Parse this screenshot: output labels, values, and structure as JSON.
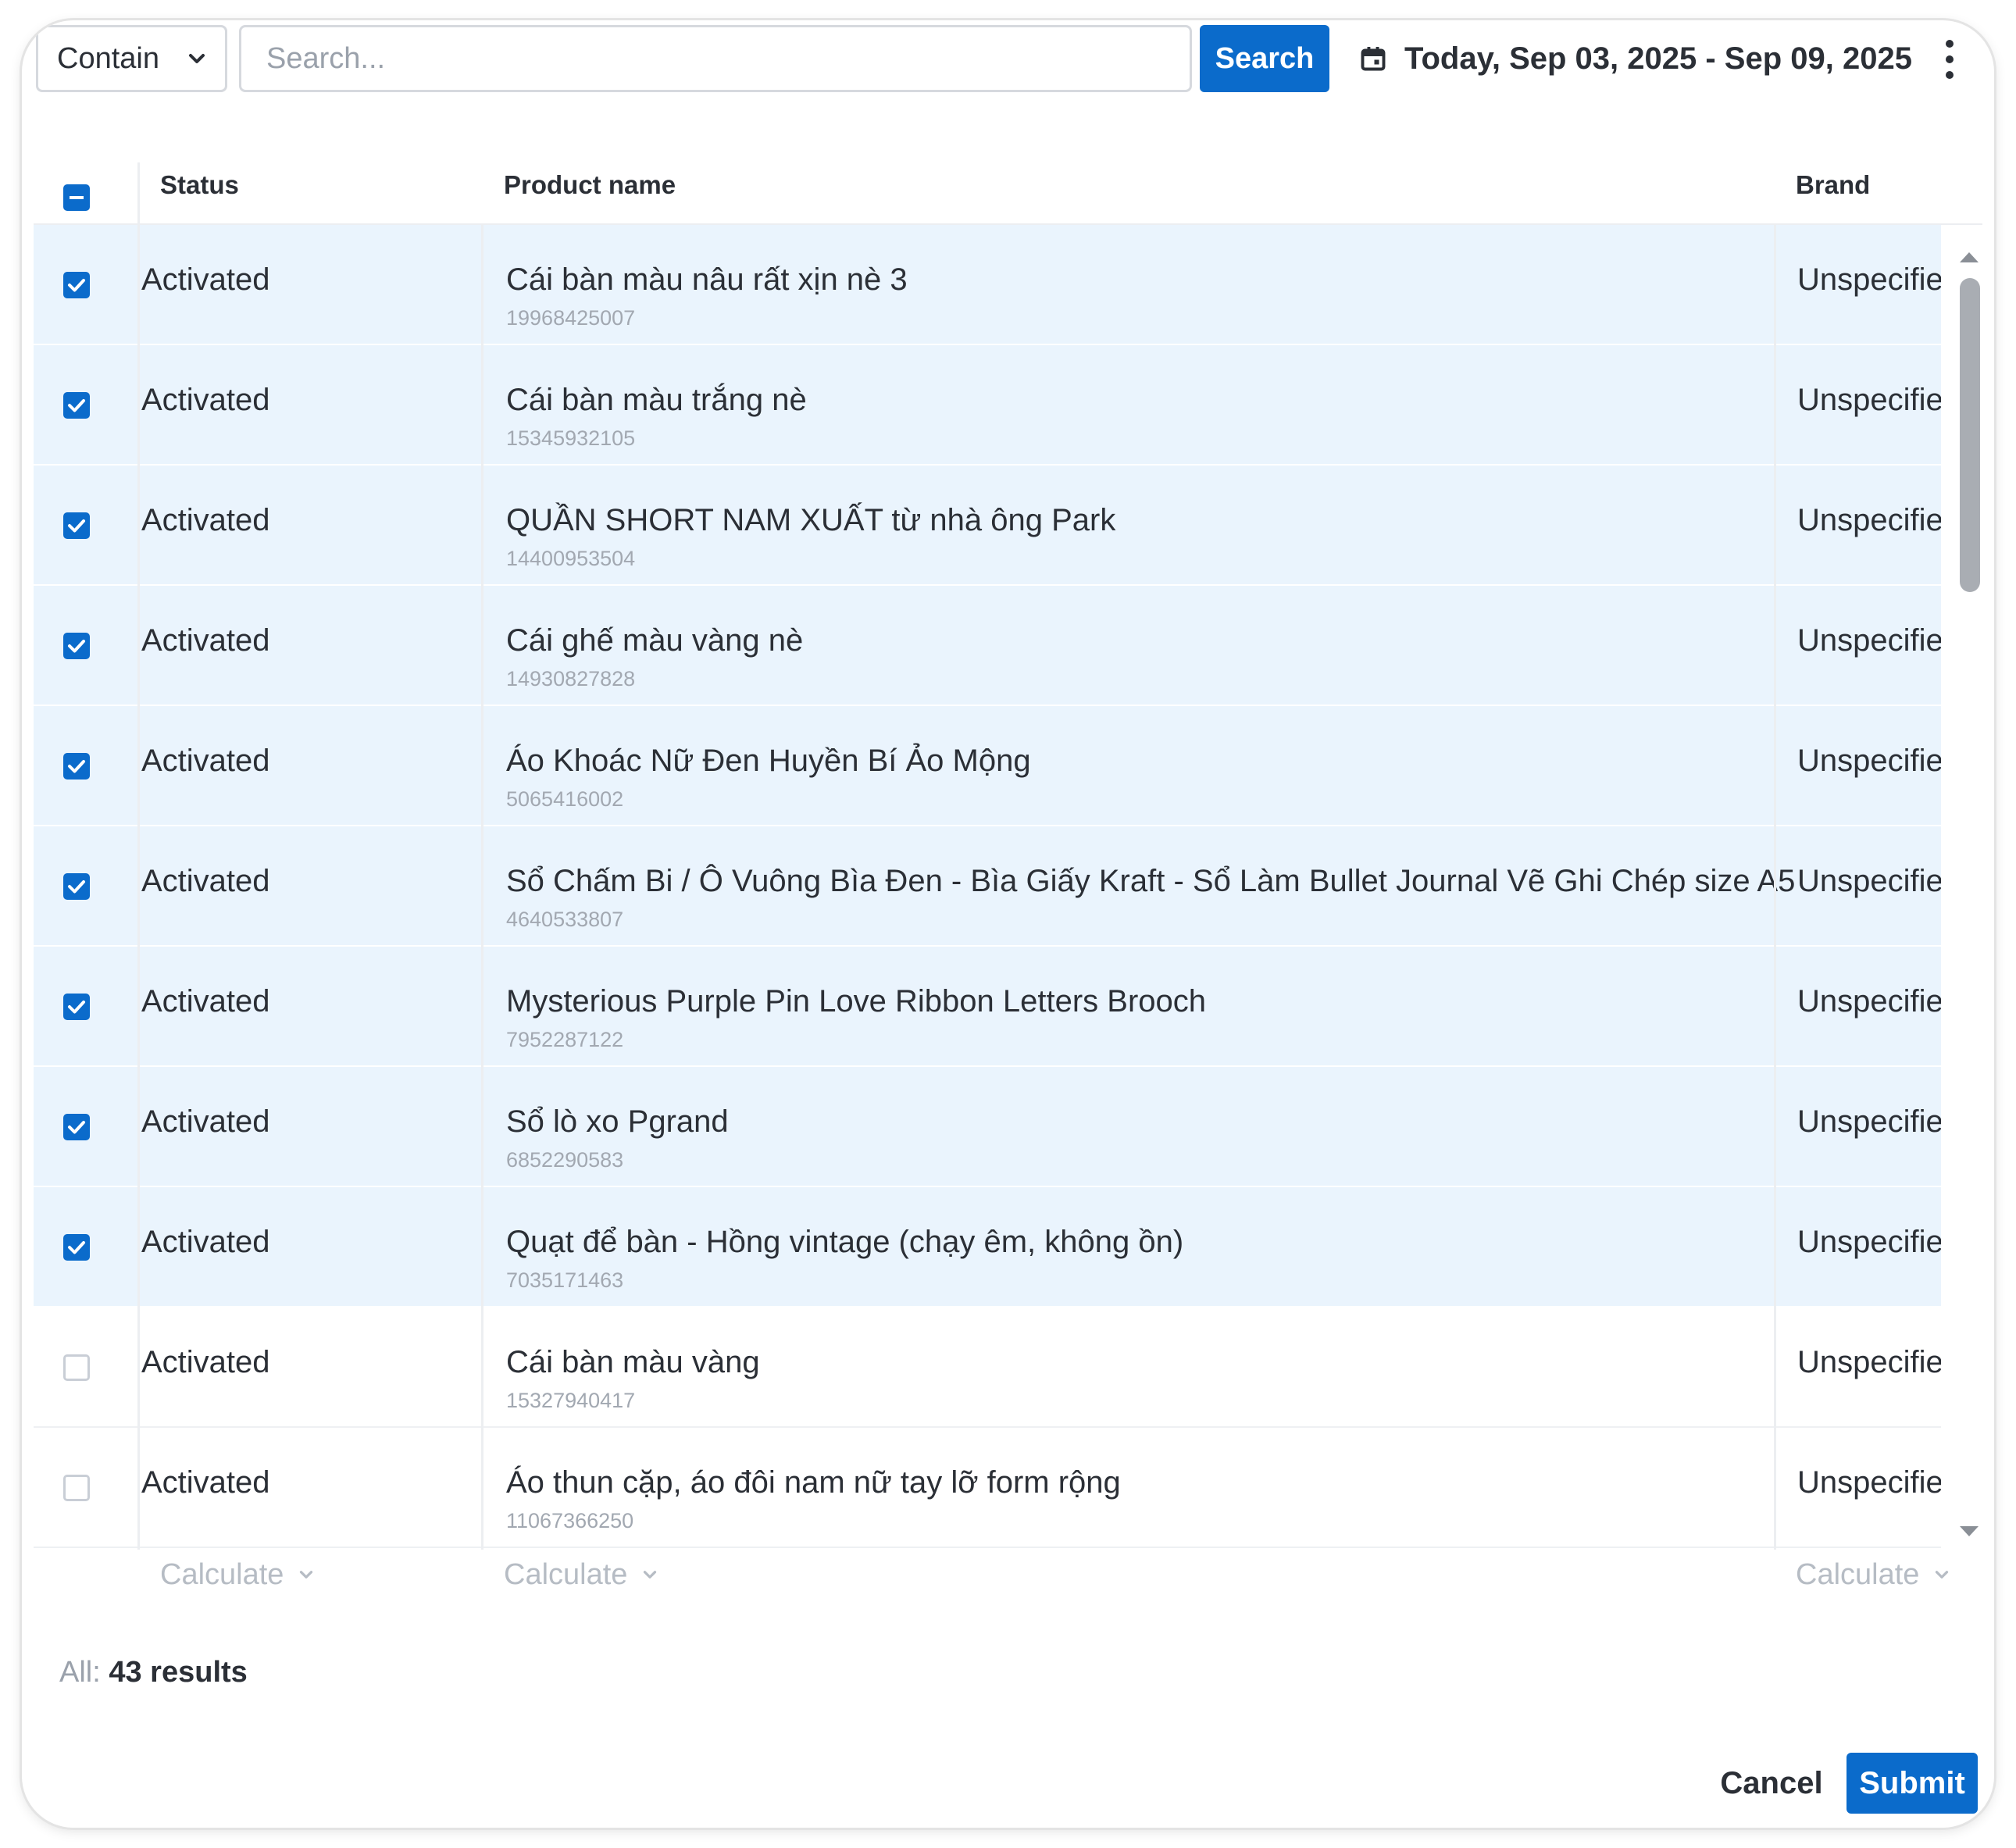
{
  "toolbar": {
    "mode_select_value": "Contain",
    "search_placeholder": "Search...",
    "search_value": "",
    "search_button_label": "Search",
    "date_range_label": "Today, Sep 03, 2025 - Sep 09, 2025"
  },
  "table": {
    "columns": {
      "status": "Status",
      "product_name": "Product name",
      "brand": "Brand"
    },
    "header_checkbox_state": "indeterminate",
    "rows": [
      {
        "selected": true,
        "status": "Activated",
        "name": "Cái bàn màu nâu rất xịn nè 3",
        "id": "19968425007",
        "brand": "Unspecified"
      },
      {
        "selected": true,
        "status": "Activated",
        "name": "Cái bàn màu trắng nè",
        "id": "15345932105",
        "brand": "Unspecified"
      },
      {
        "selected": true,
        "status": "Activated",
        "name": "QUẦN SHORT NAM XUẤT từ nhà ông Park",
        "id": "14400953504",
        "brand": "Unspecified"
      },
      {
        "selected": true,
        "status": "Activated",
        "name": "Cái ghế màu vàng nè",
        "id": "14930827828",
        "brand": "Unspecified"
      },
      {
        "selected": true,
        "status": "Activated",
        "name": "Áo Khoác Nữ Đen Huyền Bí Ảo Mộng",
        "id": "5065416002",
        "brand": "Unspecified"
      },
      {
        "selected": true,
        "status": "Activated",
        "name": "Sổ Chấm Bi / Ô Vuông Bìa Đen - Bìa Giấy Kraft - Sổ Làm Bullet Journal Vẽ Ghi Chép size A5",
        "id": "4640533807",
        "brand": "Unspecified"
      },
      {
        "selected": true,
        "status": "Activated",
        "name": "Mysterious Purple Pin Love Ribbon Letters Brooch",
        "id": "7952287122",
        "brand": "Unspecified"
      },
      {
        "selected": true,
        "status": "Activated",
        "name": "Sổ lò xo Pgrand",
        "id": "6852290583",
        "brand": "Unspecified"
      },
      {
        "selected": true,
        "status": "Activated",
        "name": "Quạt để bàn - Hồng vintage (chạy êm, không ồn)",
        "id": "7035171463",
        "brand": "Unspecified"
      },
      {
        "selected": false,
        "status": "Activated",
        "name": "Cái bàn màu vàng",
        "id": "15327940417",
        "brand": "Unspecified"
      },
      {
        "selected": false,
        "status": "Activated",
        "name": "Áo thun cặp, áo đôi nam nữ tay lỡ form rộng",
        "id": "11067366250",
        "brand": "Unspecified"
      }
    ],
    "footer": {
      "calc_label": "Calculate"
    }
  },
  "summary": {
    "prefix": "All:",
    "count_text": "43 results"
  },
  "actions": {
    "cancel_label": "Cancel",
    "submit_label": "Submit"
  },
  "colors": {
    "accent": "#0b6bcb",
    "selected_row_bg": "#eaf4fd",
    "text": "#2b2f36",
    "muted": "#9aa1ab"
  },
  "icons": {
    "mode_select": "chevron-down-icon",
    "date": "calendar-icon",
    "more": "more-vertical-icon",
    "checkbox_on": "checkbox-checked-icon",
    "checkbox_off": "checkbox-empty-icon"
  }
}
